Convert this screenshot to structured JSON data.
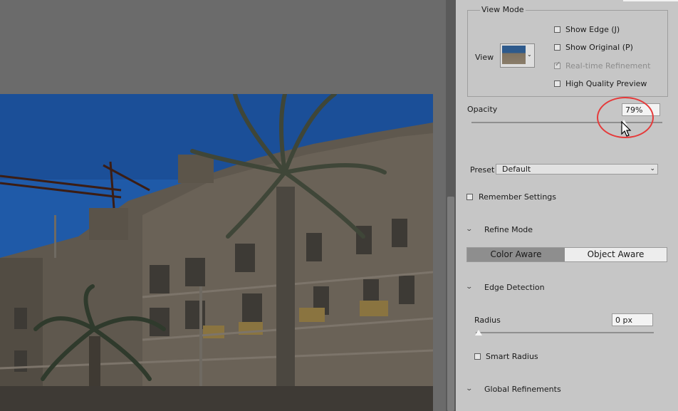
{
  "view_mode": {
    "legend": "View Mode",
    "view_label": "View",
    "options": [
      {
        "label": "Show Edge (J)",
        "checked": false,
        "enabled": true
      },
      {
        "label": "Show Original (P)",
        "checked": false,
        "enabled": true
      },
      {
        "label": "Real-time Refinement",
        "checked": true,
        "enabled": false
      },
      {
        "label": "High Quality Preview",
        "checked": false,
        "enabled": true
      }
    ]
  },
  "opacity": {
    "label": "Opacity",
    "value": "79%",
    "level": 0.79
  },
  "preset": {
    "label": "Preset",
    "value": "Default"
  },
  "remember_settings": {
    "label": "Remember Settings",
    "checked": false
  },
  "refine_mode": {
    "title": "Refine Mode",
    "options": [
      "Color Aware",
      "Object Aware"
    ],
    "selected": "Color Aware"
  },
  "edge_detection": {
    "title": "Edge Detection",
    "radius_label": "Radius",
    "radius_value": "0 px",
    "radius_level": 0,
    "smart_radius_label": "Smart Radius",
    "smart_radius_checked": false
  },
  "global_refinements": {
    "title": "Global Refinements"
  },
  "colors": {
    "panel_bg": "#c6c6c6",
    "canvas_bg": "#6b6b6b",
    "annotation": "#e53a3a",
    "selected_segment": "#8e8e8e"
  },
  "icons": [
    "chevron-down-icon",
    "dropdown-arrow-icon",
    "mouse-pointer-icon"
  ]
}
